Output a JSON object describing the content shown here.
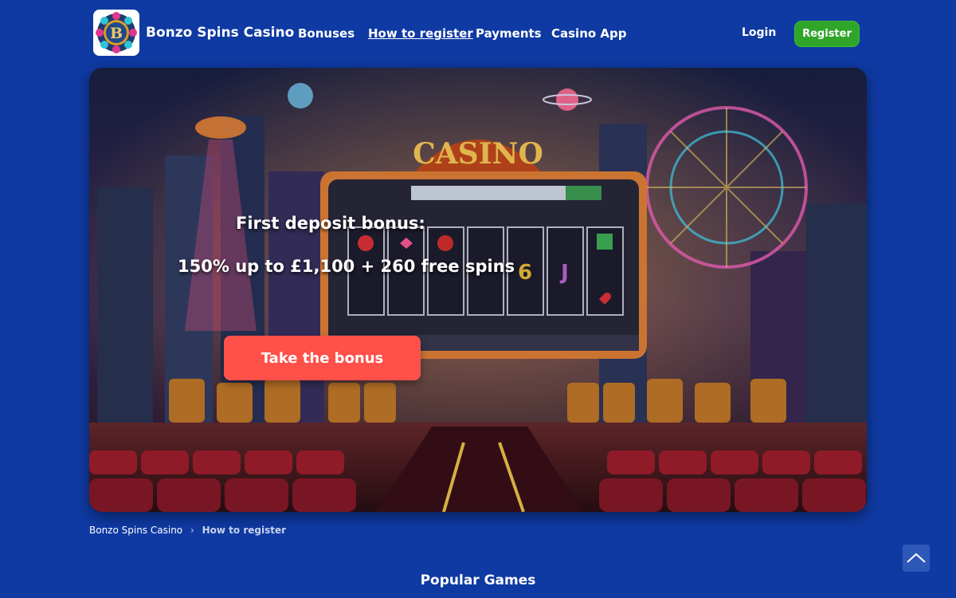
{
  "header": {
    "site_name": "Bonzo Spins Casino",
    "logo_letter": "B",
    "nav": [
      {
        "label": "Bonuses",
        "active": false
      },
      {
        "label": "How to register",
        "active": true
      },
      {
        "label": "Payments",
        "active": false
      },
      {
        "label": "Casino App",
        "active": false
      }
    ],
    "login_label": "Login",
    "register_label": "Register"
  },
  "hero": {
    "title": "First deposit bonus:",
    "subtitle": "150% up to £1,100 + 260 free spins",
    "cta_label": "Take the bonus",
    "marquee_text": "CASINO"
  },
  "breadcrumb": {
    "home": "Bonzo Spins Casino",
    "separator": "›",
    "current": "How to register"
  },
  "section": {
    "popular_games_title": "Popular Games"
  },
  "colors": {
    "page_bg": "#0f3aa3",
    "register_green": "#2fa52a",
    "cta_red": "#ff5049",
    "scroll_top_bg": "#2e58b8"
  },
  "icons": {
    "scroll_top": "chevron-up-icon",
    "logo": "casino-logo-icon"
  }
}
